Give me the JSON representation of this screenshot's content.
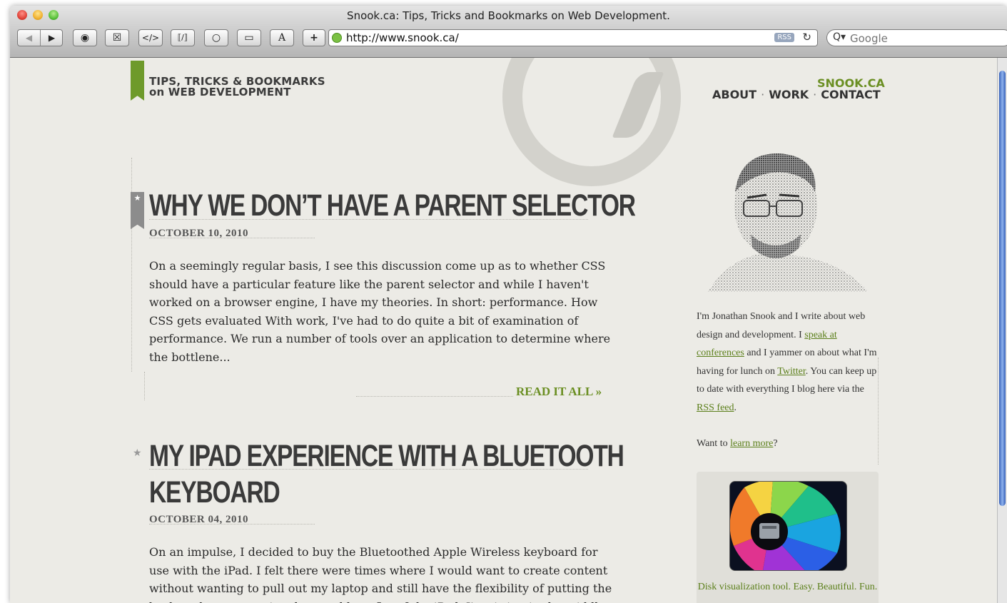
{
  "window": {
    "title": "Snook.ca: Tips, Tricks and Bookmarks on Web Development."
  },
  "toolbar": {
    "back_icon": "◀",
    "forward_icon": "▶",
    "buttons": [
      "◉",
      "☒",
      "</>",
      "⟦/⟧",
      "○",
      "▭",
      "A",
      "+"
    ],
    "url": "http://www.snook.ca/",
    "rss_label": "RSS",
    "reload_icon": "↻",
    "search_placeholder": "Google",
    "search_icon": "Q▾"
  },
  "site": {
    "tagline_line1": "TIPS, TRICKS & BOOKMARKS",
    "tagline_line2": "on WEB DEVELOPMENT",
    "brand": "SNOOK.CA",
    "nav": [
      "ABOUT",
      "WORK",
      "CONTACT"
    ],
    "nav_separator": "·"
  },
  "posts": [
    {
      "title_line1": "WHY WE DON’T HAVE A PARENT SELECTOR",
      "date": "OCTOBER 10, 2010",
      "body": "On a seemingly regular basis, I see this discussion come up as to whether CSS should have a particular feature like the parent selector and while I haven't worked on a browser engine, I have my theories. In short: performance. How CSS gets evaluated With work, I've had to do quite a bit of examination of performance. We run a number of tools over an application to determine where the bottlene...",
      "read_more": "READ IT ALL »"
    },
    {
      "title_line1": "MY IPAD EXPERIENCE WITH A BLUETOOTH",
      "title_line2": "KEYBOARD",
      "date": "OCTOBER 04, 2010",
      "body": "On an impulse, I decided to buy the Bluetoothed Apple Wireless keyboard for use with the iPad. I felt there were times where I would want to create content without wanting to pull out my laptop and still have the flexibility of putting the keyboard away to enjoy the usual benefits of the iPad. I'm sitting in the middle"
    }
  ],
  "sidebar": {
    "bio_1": "I'm Jonathan Snook and I write about web design and development. I ",
    "bio_link_1": "speak at conferences",
    "bio_2": " and I yammer on about what I'm having for lunch on ",
    "bio_link_2": "Twitter",
    "bio_3": ". You can keep up to date with everything I blog here via the ",
    "bio_link_3": "RSS feed",
    "bio_4": ".",
    "learn_prefix": "Want to ",
    "learn_link": "learn more",
    "learn_suffix": "?",
    "ad_text": "Disk visualization tool. Easy. Beautiful. Fun."
  }
}
